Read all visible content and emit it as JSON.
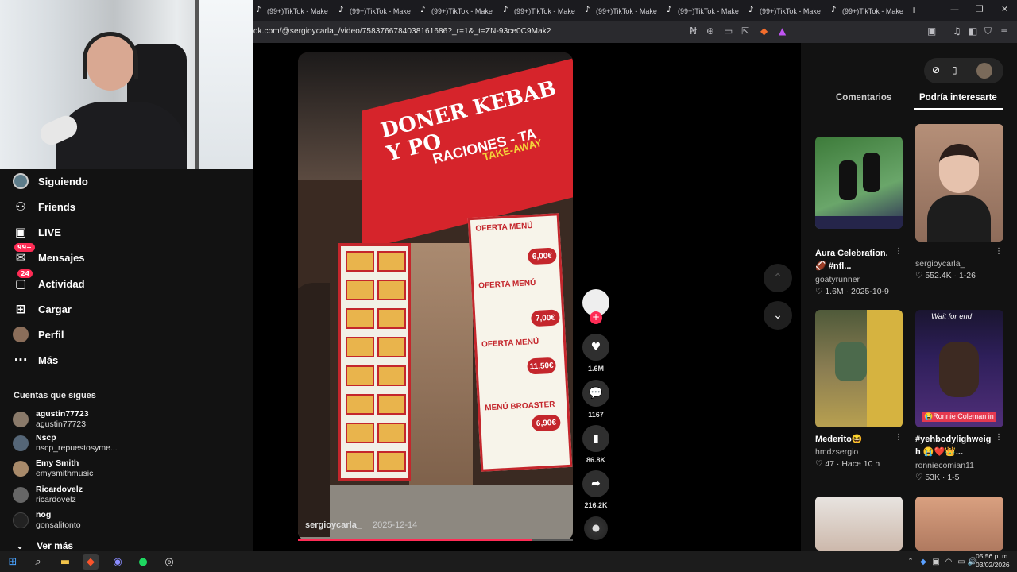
{
  "browser": {
    "tabs": [
      "(99+)TikTok - Make",
      "(99+)TikTok - Make",
      "(99+)TikTok - Make",
      "(99+)TikTok - Make",
      "(99+)TikTok - Make",
      "(99+)TikTok - Make",
      "(99+)TikTok - Make",
      "(99+)TikTok - Make"
    ],
    "new_tab": "+",
    "url": "tok.com/@sergioycarla_/video/7583766784038161686?_r=1&_t=ZN-93ce0C9Mak2"
  },
  "sidebar": {
    "items": [
      {
        "label": "Siguiendo",
        "icon": "avatar"
      },
      {
        "label": "Friends",
        "icon": "friends-icon"
      },
      {
        "label": "LIVE",
        "icon": "live-icon"
      },
      {
        "label": "Mensajes",
        "icon": "messages-icon",
        "badge": "99+"
      },
      {
        "label": "Actividad",
        "icon": "activity-icon",
        "badge": "24"
      },
      {
        "label": "Cargar",
        "icon": "upload-icon"
      },
      {
        "label": "Perfil",
        "icon": "avatar"
      },
      {
        "label": "Más",
        "icon": "more-icon"
      }
    ],
    "following_heading": "Cuentas que sigues",
    "accounts": [
      {
        "name": "agustin77723",
        "handle": "agustin77723",
        "color": "#8a7a6a"
      },
      {
        "name": "Nscp",
        "handle": "nscp_repuestosyme...",
        "color": "#556677"
      },
      {
        "name": "Emy Smith",
        "handle": "emysmithmusic",
        "color": "#a88a6a"
      },
      {
        "name": "Ricardovelz",
        "handle": "ricardovelz",
        "color": "#666666"
      },
      {
        "name": "nog",
        "handle": "gonsalitonto",
        "color": "#222222"
      }
    ],
    "see_more": "Ver más"
  },
  "video": {
    "author": "sergioycarla_",
    "date": "2025-12-14",
    "progress": 0.85,
    "sign_line1": "DONER KEBAB Y PO",
    "sign_line2": "RACIONES - TA",
    "sign_line3": "TAKE-AWAY",
    "menu": [
      {
        "title": "OFERTA MENÚ",
        "price": "6,00€"
      },
      {
        "title": "OFERTA MENÚ",
        "price": "7,00€"
      },
      {
        "title": "OFERTA MENÚ",
        "price": "11,50€"
      },
      {
        "title": "MENÚ BROASTER",
        "price": "6,90€"
      }
    ]
  },
  "actions": {
    "likes": "1.6M",
    "comments": "1167",
    "saves": "86.8K",
    "shares": "216.2K"
  },
  "right_panel": {
    "tabs": [
      "Comentarios",
      "Podría interesarte"
    ],
    "cards": [
      {
        "title_l1": "Aura Celebration.",
        "title_l2": "🏈 #nfl...",
        "author": "goatyrunner",
        "stats": "♡ 1.6M · 2025-10-9"
      },
      {
        "title_l1": "",
        "title_l2": "",
        "author": "sergioycarla_",
        "stats": "♡ 552.4K · 1-26"
      },
      {
        "title_l1": "Mederito😆",
        "title_l2": "",
        "author": "hmdzsergio",
        "stats": "♡ 47 · Hace 10 h"
      },
      {
        "title_l1": "#yehbodylighweig",
        "title_l2": "h 😭❤️👑...",
        "author": "ronniecomian11",
        "stats": "♡ 53K · 1-5"
      }
    ],
    "overlay_wait": "Wait for end",
    "overlay_ronnie": "😭Ronnie Coleman in"
  },
  "taskbar": {
    "time": "05:56 p. m.",
    "date": "03/02/2026"
  }
}
